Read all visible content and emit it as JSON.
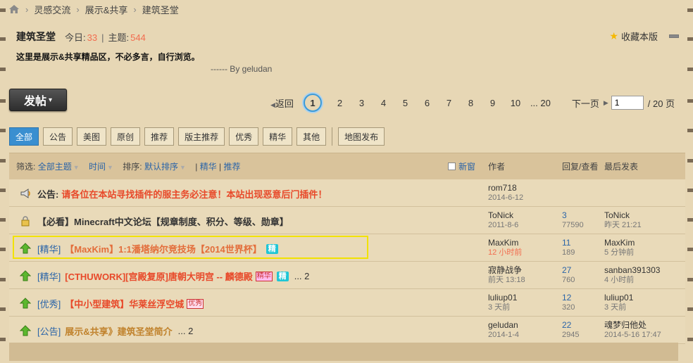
{
  "breadcrumb": {
    "items": [
      "灵感交流",
      "展示&共享",
      "建筑圣堂"
    ]
  },
  "forum": {
    "title": "建筑圣堂",
    "today_label": "今日:",
    "today_value": "33",
    "topics_label": "主题:",
    "topics_value": "544",
    "favorite_label": "收藏本版",
    "description": "这里是展示&共享精品区，不必多言，自行浏览。",
    "byline": "------ By geludan"
  },
  "toolbar": {
    "post_label": "发帖"
  },
  "pager": {
    "prev_label": "返回",
    "current": "1",
    "pages": [
      "2",
      "3",
      "4",
      "5",
      "6",
      "7",
      "8",
      "9",
      "10"
    ],
    "last": "... 20",
    "next_label": "下一页",
    "input_value": "1",
    "total": "/ 20 页"
  },
  "type_tabs": [
    "全部",
    "公告",
    "美图",
    "原创",
    "推荐",
    "版主推荐",
    "优秀",
    "精华",
    "其他"
  ],
  "extra_tab": "地图发布",
  "thead": {
    "filter_label": "筛选:",
    "all_topics": "全部主题",
    "time": "时间",
    "sort_label": "排序:",
    "default_sort": "默认排序",
    "digest": "精华",
    "recommend": "推荐",
    "new_window": "新窗",
    "author": "作者",
    "replies": "回复/查看",
    "last_post": "最后发表"
  },
  "threads": [
    {
      "cat": "",
      "prefix": "公告:",
      "title": "请各位在本站寻找插件的服主务必注意！本站出现恶意后门插件！",
      "author": "rom718",
      "date": "2014-6-12",
      "replies": "",
      "views": "",
      "last_user": "",
      "last_time": ""
    },
    {
      "cat": "",
      "prefix": "",
      "title": "【必看】Minecraft中文论坛【规章制度、积分、等级、勋章】",
      "author": "ToNick",
      "date": "2011-8-6",
      "replies": "3",
      "views": "77590",
      "last_user": "ToNick",
      "last_time": "昨天 21:21"
    },
    {
      "cat": "[精华]",
      "prefix": "",
      "title": "【MaxKim】1:1潘塔纳尔竞技场【2014世界杯】",
      "tag": "精",
      "author": "MaxKim",
      "date": "12 小时前",
      "replies": "11",
      "views": "189",
      "last_user": "MaxKim",
      "last_time": "5 分钟前"
    },
    {
      "cat": "[精华]",
      "prefix": "",
      "title": "[CTHUWORK][宫殿复原]唐朝大明宫 -- 麟德殿",
      "tag2": "精华",
      "tag": "精",
      "more": "... 2",
      "author": "寂静战争",
      "date": "前天 13:18",
      "replies": "27",
      "views": "760",
      "last_user": "sanban391303",
      "last_time": "4 小时前"
    },
    {
      "cat": "[优秀]",
      "prefix": "",
      "title": "【中小型建筑】华莱丝浮空城",
      "tag3": "优秀",
      "author": "luliup01",
      "date": "3 天前",
      "replies": "12",
      "views": "320",
      "last_user": "luliup01",
      "last_time": "3 天前"
    },
    {
      "cat": "[公告]",
      "prefix": "",
      "title": "展示&共享》建筑圣堂简介",
      "more": "... 2",
      "author": "geludan",
      "date": "2014-1-4",
      "replies": "22",
      "views": "2945",
      "last_user": "魂梦归他处",
      "last_time": "2014-5-16 17:47"
    }
  ],
  "colors": {
    "accent": "#3a8fd0",
    "highlight": "#f2e200",
    "title_red": "#e8492a"
  }
}
